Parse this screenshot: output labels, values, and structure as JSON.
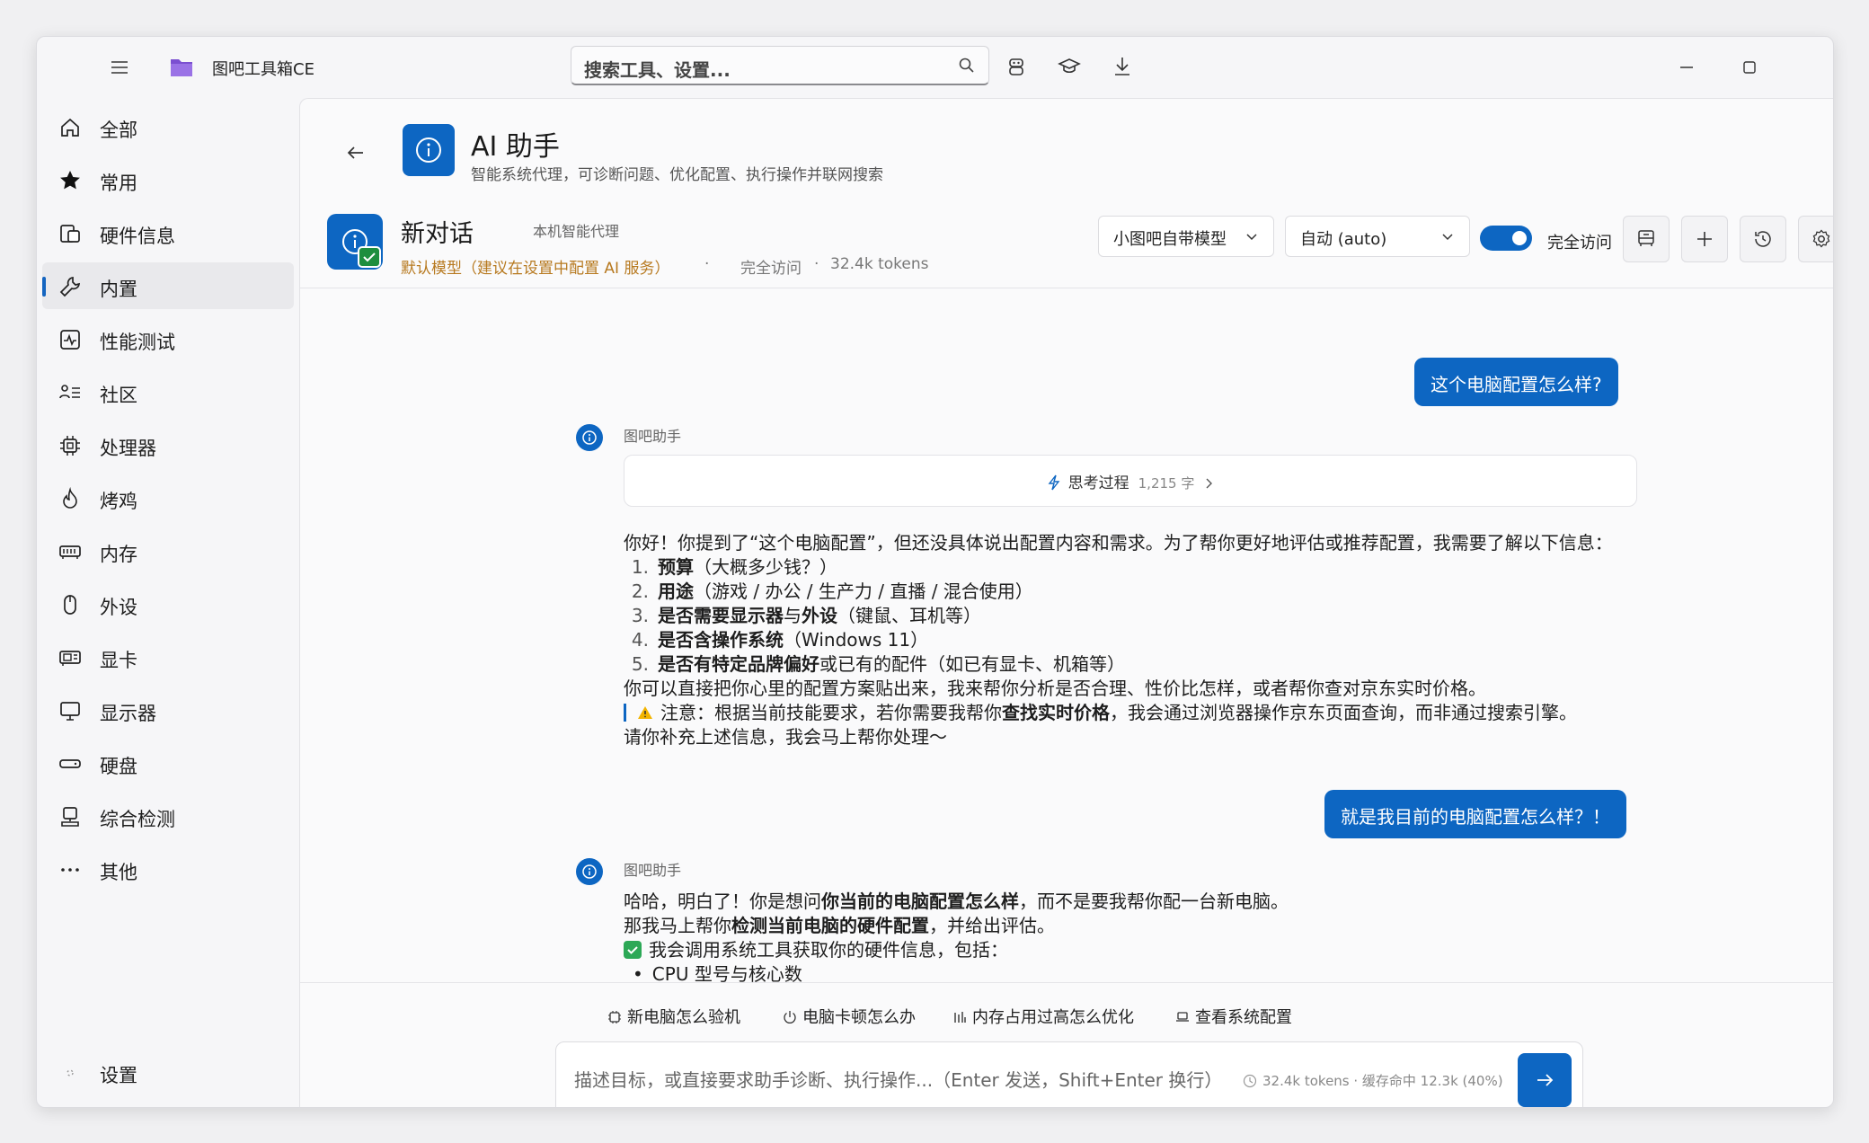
{
  "titlebar": {
    "app_name": "图吧工具箱CE",
    "search_placeholder": "搜索工具、设置..."
  },
  "sidebar": {
    "items": [
      {
        "label": "全部",
        "icon": "home-icon"
      },
      {
        "label": "常用",
        "icon": "star-icon"
      },
      {
        "label": "硬件信息",
        "icon": "hardware-icon"
      },
      {
        "label": "内置",
        "icon": "wrench-icon",
        "active": true
      },
      {
        "label": "性能测试",
        "icon": "pulse-icon"
      },
      {
        "label": "社区",
        "icon": "community-icon"
      },
      {
        "label": "处理器",
        "icon": "cpu-icon"
      },
      {
        "label": "烤鸡",
        "icon": "flame-icon"
      },
      {
        "label": "内存",
        "icon": "memory-icon"
      },
      {
        "label": "外设",
        "icon": "mouse-icon"
      },
      {
        "label": "显卡",
        "icon": "gpu-icon"
      },
      {
        "label": "显示器",
        "icon": "monitor-icon"
      },
      {
        "label": "硬盘",
        "icon": "disk-icon"
      },
      {
        "label": "综合检测",
        "icon": "diagnostics-icon"
      },
      {
        "label": "其他",
        "icon": "more-icon"
      }
    ],
    "settings_label": "设置"
  },
  "header": {
    "title": "AI 助手",
    "subtitle": "智能系统代理，可诊断问题、优化配置、执行操作并联网搜索"
  },
  "conversation": {
    "title": "新对话",
    "tag": "本机智能代理",
    "model_note": "默认模型（建议在设置中配置 AI 服务）",
    "access": "完全访问",
    "tokens": "32.4k tokens",
    "separator": "·"
  },
  "controls": {
    "model_select": "小图吧自带模型",
    "mode_select": "自动 (auto)",
    "toggle_label": "完全访问",
    "toggle_on": true
  },
  "messages": {
    "user1": "这个电脑配置怎么样?",
    "bot_name": "图吧助手",
    "thinking_label": "思考过程",
    "thinking_count": "1,215 字",
    "bot1": {
      "intro": "你好！你提到了“这个电脑配置”，但还没具体说出配置内容和需求。为了帮你更好地评估或推荐配置，我需要了解以下信息：",
      "items": [
        {
          "num": "1.",
          "bold": "预算",
          "rest": "（大概多少钱？）"
        },
        {
          "num": "2.",
          "bold": "用途",
          "rest": "（游戏 / 办公 / 生产力 / 直播 / 混合使用）"
        },
        {
          "num": "3.",
          "bold": "是否需要显示器",
          "mid": "与",
          "bold2": "外设",
          "rest": "（键鼠、耳机等）"
        },
        {
          "num": "4.",
          "bold": "是否含操作系统",
          "rest": "（Windows 11）"
        },
        {
          "num": "5.",
          "bold": "是否有特定品牌偏好",
          "rest": "或已有的配件（如已有显卡、机箱等）"
        }
      ],
      "paste_line": "你可以直接把你心里的配置方案贴出来，我来帮你分析是否合理、性价比怎样，或者帮你查对京东实时价格。",
      "note_prefix": "注意：根据当前技能要求，若你需要我帮你",
      "note_bold": "查找实时价格",
      "note_suffix": "，我会通过浏览器操作京东页面查询，而非通过搜索引擎。",
      "closing": "请你补充上述信息，我会马上帮你处理～"
    },
    "user2": "就是我目前的电脑配置怎么样？！",
    "bot2": {
      "l1_a": "哈哈，明白了！你是想问",
      "l1_b": "你当前的电脑配置怎么样",
      "l1_c": "，而不是要我帮你配一台新电脑。",
      "l2_a": "那我马上帮你",
      "l2_b": "检测当前电脑的硬件配置",
      "l2_c": "，并给出评估。",
      "l3": "我会调用系统工具获取你的硬件信息，包括：",
      "l4": "CPU 型号与核心数"
    }
  },
  "suggestions": [
    {
      "label": "新电脑怎么验机",
      "icon": "chip-icon"
    },
    {
      "label": "电脑卡顿怎么办",
      "icon": "power-icon"
    },
    {
      "label": "内存占用过高怎么优化",
      "icon": "bars-icon"
    },
    {
      "label": "查看系统配置",
      "icon": "laptop-icon"
    }
  ],
  "input": {
    "placeholder": "描述目标，或直接要求助手诊断、执行操作...（Enter 发送，Shift+Enter 换行）",
    "stats": "32.4k tokens · 缓存命中 12.3k (40%)"
  },
  "colors": {
    "accent": "#0d66c2",
    "model_note": "#b7791f",
    "success": "#2ca856"
  }
}
